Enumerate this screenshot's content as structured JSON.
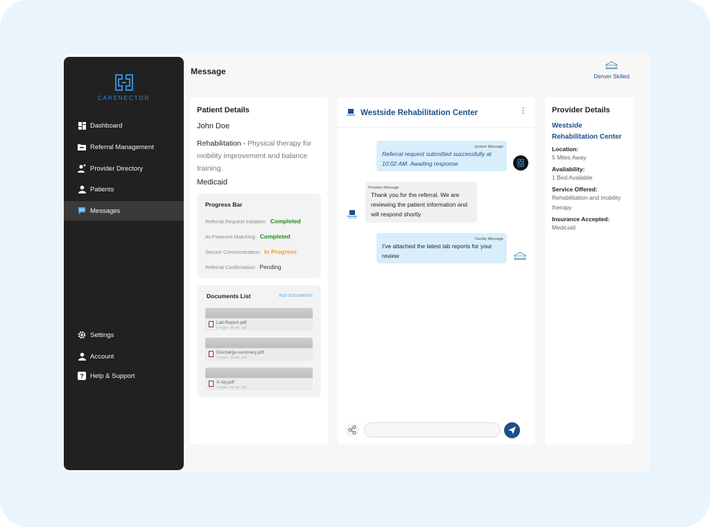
{
  "app": {
    "logo_text": "CARENECTOR"
  },
  "sidebar": {
    "items": [
      {
        "label": "Dashboard",
        "icon": "dashboard-icon"
      },
      {
        "label": "Referral Management",
        "icon": "folder-icon"
      },
      {
        "label": "Provider Directory",
        "icon": "user-plus-icon"
      },
      {
        "label": "Patients",
        "icon": "user-icon"
      },
      {
        "label": "Messages",
        "icon": "chat-icon"
      }
    ],
    "bottom_items": [
      {
        "label": "Settings",
        "icon": "gear-icon"
      },
      {
        "label": "Account",
        "icon": "user-icon"
      },
      {
        "label": "Help & Support",
        "icon": "help-icon"
      }
    ]
  },
  "header": {
    "title": "Message",
    "user_name": "Denver Skilled"
  },
  "patient": {
    "title": "Patient Details",
    "name": "John Doe",
    "service": "Rehabilitation",
    "service_detail": "Physical therapy for mobility improvement and balance training.",
    "insurance": "Medicaid",
    "progress": {
      "title": "Progress Bar",
      "rows": [
        {
          "label": "Referral Request Initiation:",
          "status": "Completed"
        },
        {
          "label": "AI-Powered Matching:",
          "status": "Completed"
        },
        {
          "label": "Secure Communication:",
          "status": "In Progress"
        },
        {
          "label": "Referral Confirmation:",
          "status": "Pending"
        }
      ]
    },
    "documents": {
      "title": "Documents List",
      "add_label": "ADD DOCUMENTS",
      "items": [
        {
          "name": "Lab-Report.pdf",
          "meta": "5 Pages · 96 KB · pdf"
        },
        {
          "name": "Discharge-summary.pdf",
          "meta": "3 Pages · 80 KB · pdf"
        },
        {
          "name": "X-ray.pdf",
          "meta": "2 Pages · 96 KB · pdf"
        }
      ]
    }
  },
  "chat": {
    "title": "Westside Rehabilitation Center",
    "messages": [
      {
        "tag": "System Message",
        "text": "Referral request submitted successfully at 10:02 AM. Awaiting response"
      },
      {
        "tag": "Provider Message",
        "text": "Thank you for the referral. We are reviewing the patient information and will respond shortly"
      },
      {
        "tag": "Facility Message",
        "text": "I've attached the latest lab reports for your review"
      }
    ],
    "input_placeholder": ""
  },
  "provider": {
    "title": "Provider Details",
    "name": "Westside Rehabilitation Center",
    "fields": [
      {
        "label": "Location:",
        "value": "5 Miles Away"
      },
      {
        "label": "Availability:",
        "value": "1 Bed Available"
      },
      {
        "label": "Service Offered:",
        "value": "Rehabilitation and mobility therapy"
      },
      {
        "label": "Insurance Accepted:",
        "value": "Medicaid"
      }
    ]
  },
  "colors": {
    "sidebar": "#212121",
    "accent": "#1d4e8c",
    "completed": "#1f8a1f",
    "in_progress": "#f0a010",
    "bubble": "#d8eefb"
  }
}
